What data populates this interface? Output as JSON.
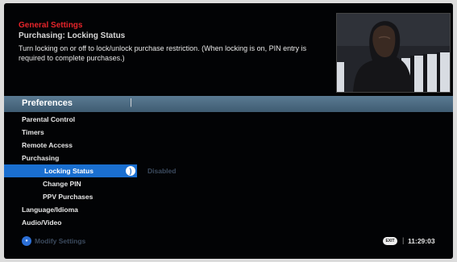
{
  "header": {
    "title": "General Settings",
    "subtitle": "Purchasing: Locking Status",
    "description": "Turn locking on or off to lock/unlock purchase restriction. (When locking is on, PIN entry is required to complete purchases.)"
  },
  "topbar": {
    "label": "Preferences",
    "separator": "|"
  },
  "menu": {
    "parental_control": "Parental Control",
    "timers": "Timers",
    "remote_access": "Remote Access",
    "purchasing": "Purchasing",
    "locking_status": "Locking Status",
    "locking_status_cap": ")",
    "locking_status_value": "Disabled",
    "change_pin": "Change PIN",
    "ppv_purchases": "PPV Purchases",
    "language": "Language/Idioma",
    "audio_video": "Audio/Video"
  },
  "footer": {
    "modify_label": "Modify Settings",
    "blue_button_icon": "blue-button-icon",
    "exit_label": "EXIT",
    "separator": "|",
    "time": "11:29:03"
  },
  "colors": {
    "accent": "#1a6fd0",
    "title_red": "#e8242a",
    "bar": "#4a6a82"
  }
}
